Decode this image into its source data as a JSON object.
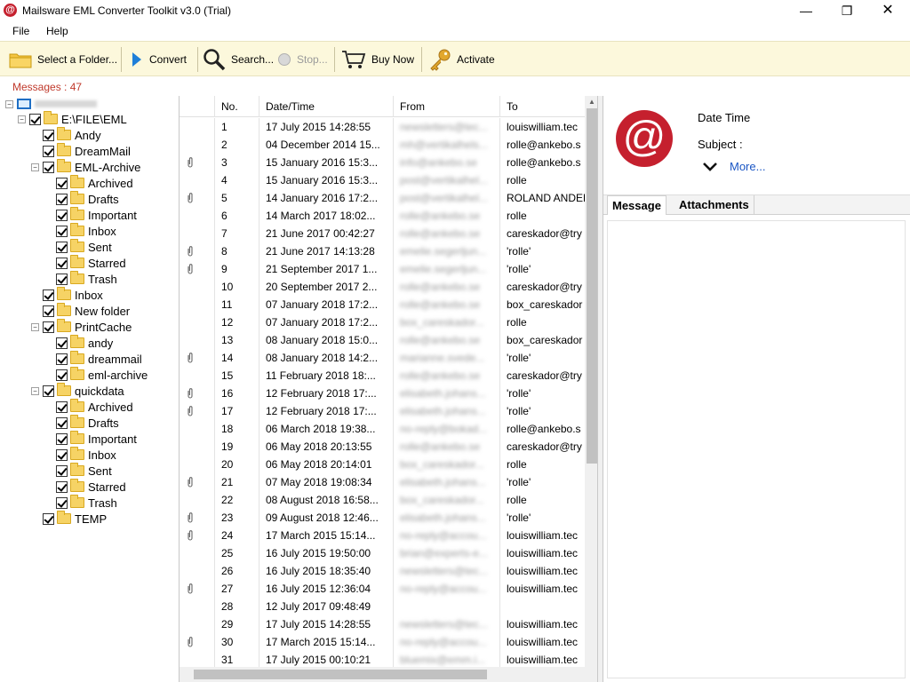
{
  "window": {
    "title": "Mailsware EML Converter Toolkit v3.0 (Trial)",
    "app_icon": "@",
    "minimize": "—",
    "maximize": "❐",
    "close": "✕"
  },
  "menu": {
    "file": "File",
    "help": "Help"
  },
  "toolbar": {
    "select_folder": "Select a Folder...",
    "convert": "Convert",
    "search": "Search...",
    "stop": "Stop...",
    "buy_now": "Buy Now",
    "activate": "Activate"
  },
  "status": {
    "messages": "Messages : 47"
  },
  "tree": {
    "root_drive": "E:\\FILE\\EML",
    "andy": "Andy",
    "dreammail": "DreamMail",
    "eml_archive": "EML-Archive",
    "archived": "Archived",
    "drafts": "Drafts",
    "important": "Important",
    "inbox": "Inbox",
    "sent": "Sent",
    "starred": "Starred",
    "trash": "Trash",
    "inbox_top": "Inbox",
    "new_folder": "New folder",
    "printcache": "PrintCache",
    "pc_andy": "andy",
    "pc_dreammail": "dreammail",
    "pc_eml_archive": "eml-archive",
    "quickdata": "quickdata",
    "q_archived": "Archived",
    "q_drafts": "Drafts",
    "q_important": "Important",
    "q_inbox": "Inbox",
    "q_sent": "Sent",
    "q_starred": "Starred",
    "q_trash": "Trash",
    "temp": "TEMP"
  },
  "list": {
    "headers": {
      "no": "No.",
      "date": "Date/Time",
      "from": "From",
      "to": "To"
    },
    "rows": [
      {
        "att": false,
        "no": "1",
        "date": "17 July 2015 14:28:55",
        "from": "newsletters@tec...",
        "to": "louiswilliam.tec"
      },
      {
        "att": false,
        "no": "2",
        "date": "04 December 2014 15...",
        "from": "mh@vertikalhels...",
        "to": "rolle@ankebo.s"
      },
      {
        "att": true,
        "no": "3",
        "date": "15 January 2016 15:3...",
        "from": "info@ankebo.se",
        "to": "rolle@ankebo.s"
      },
      {
        "att": false,
        "no": "4",
        "date": "15 January 2016 15:3...",
        "from": "post@vertikalhel...",
        "to": "rolle"
      },
      {
        "att": true,
        "no": "5",
        "date": "14 January 2016 17:2...",
        "from": "post@vertikalhel...",
        "to": "ROLAND ANDER"
      },
      {
        "att": false,
        "no": "6",
        "date": "14 March 2017 18:02...",
        "from": "rolle@ankebo.se",
        "to": "rolle"
      },
      {
        "att": false,
        "no": "7",
        "date": "21 June 2017 00:42:27",
        "from": "rolle@ankebo.se",
        "to": "careskador@try"
      },
      {
        "att": true,
        "no": "8",
        "date": "21 June 2017 14:13:28",
        "from": "emelie.segerljun...",
        "to": "'rolle'"
      },
      {
        "att": true,
        "no": "9",
        "date": "21 September 2017 1...",
        "from": "emelie.segerljun...",
        "to": "'rolle'"
      },
      {
        "att": false,
        "no": "10",
        "date": "20 September 2017 2...",
        "from": "rolle@ankebo.se",
        "to": "careskador@try"
      },
      {
        "att": false,
        "no": "11",
        "date": "07 January 2018 17:2...",
        "from": "rolle@ankebo.se",
        "to": "box_careskador"
      },
      {
        "att": false,
        "no": "12",
        "date": "07 January 2018 17:2...",
        "from": "box_careskador...",
        "to": "rolle"
      },
      {
        "att": false,
        "no": "13",
        "date": "08 January 2018 15:0...",
        "from": "rolle@ankebo.se",
        "to": "box_careskador"
      },
      {
        "att": true,
        "no": "14",
        "date": "08 January 2018 14:2...",
        "from": "marianne.svede...",
        "to": "'rolle'"
      },
      {
        "att": false,
        "no": "15",
        "date": "11 February 2018 18:...",
        "from": "rolle@ankebo.se",
        "to": "careskador@try"
      },
      {
        "att": true,
        "no": "16",
        "date": "12 February 2018 17:...",
        "from": "elisabeth.johans...",
        "to": "'rolle'"
      },
      {
        "att": true,
        "no": "17",
        "date": "12 February 2018 17:...",
        "from": "elisabeth.johans...",
        "to": "'rolle'"
      },
      {
        "att": false,
        "no": "18",
        "date": "06 March 2018 19:38...",
        "from": "no-reply@bokad...",
        "to": "rolle@ankebo.s"
      },
      {
        "att": false,
        "no": "19",
        "date": "06 May 2018 20:13:55",
        "from": "rolle@ankebo.se",
        "to": "careskador@try"
      },
      {
        "att": false,
        "no": "20",
        "date": "06 May 2018 20:14:01",
        "from": "box_careskador...",
        "to": "rolle"
      },
      {
        "att": true,
        "no": "21",
        "date": "07 May 2018 19:08:34",
        "from": "elisabeth.johans...",
        "to": "'rolle'"
      },
      {
        "att": false,
        "no": "22",
        "date": "08 August 2018 16:58...",
        "from": "box_careskador...",
        "to": "rolle"
      },
      {
        "att": true,
        "no": "23",
        "date": "09 August 2018 12:46...",
        "from": "elisabeth.johans...",
        "to": "'rolle'"
      },
      {
        "att": true,
        "no": "24",
        "date": "17 March 2015 15:14...",
        "from": "no-reply@accou...",
        "to": "louiswilliam.tec"
      },
      {
        "att": false,
        "no": "25",
        "date": "16 July 2015 19:50:00",
        "from": "brian@experts-e...",
        "to": "louiswilliam.tec"
      },
      {
        "att": false,
        "no": "26",
        "date": "16 July 2015 18:35:40",
        "from": "newsletters@tec...",
        "to": "louiswilliam.tec"
      },
      {
        "att": true,
        "no": "27",
        "date": "16 July 2015 12:36:04",
        "from": "no-reply@accou...",
        "to": "louiswilliam.tec"
      },
      {
        "att": false,
        "no": "28",
        "date": "12 July 2017 09:48:49",
        "from": "",
        "to": ""
      },
      {
        "att": false,
        "no": "29",
        "date": "17 July 2015 14:28:55",
        "from": "newsletters@tec...",
        "to": "louiswilliam.tec"
      },
      {
        "att": true,
        "no": "30",
        "date": "17 March 2015 15:14...",
        "from": "no-reply@accou...",
        "to": "louiswilliam.tec"
      },
      {
        "att": false,
        "no": "31",
        "date": "17 July 2015 00:10:21",
        "from": "bluemix@emm.i...",
        "to": "louiswilliam.tec"
      }
    ]
  },
  "preview": {
    "avatar": "@",
    "date_time": "Date Time",
    "subject": "Subject :",
    "more": "More...",
    "tab_message": "Message",
    "tab_attachments": "Attachments"
  },
  "colors": {
    "toolbar_bg": "#fcf8dc",
    "brand_red": "#c5202e",
    "link_blue": "#1a56c4",
    "status_red": "#c0392b"
  }
}
